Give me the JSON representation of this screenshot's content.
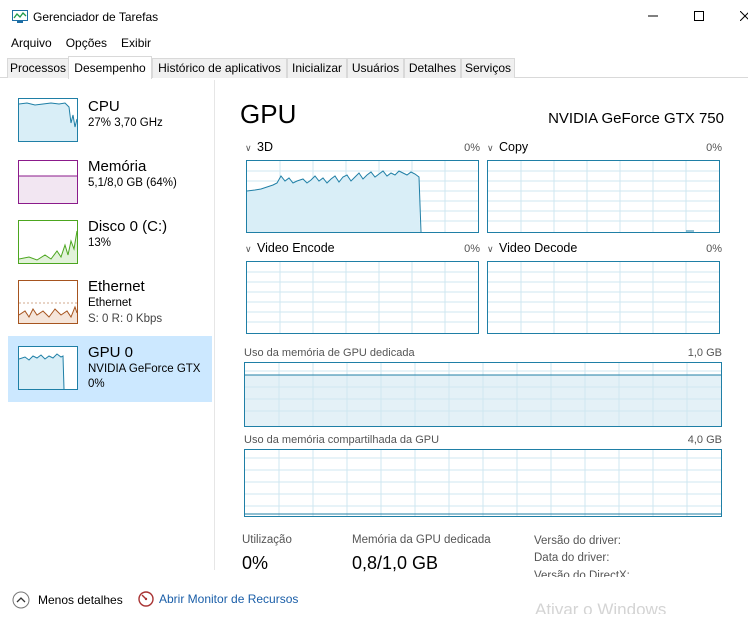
{
  "window": {
    "title": "Gerenciador de Tarefas"
  },
  "menu": [
    "Arquivo",
    "Opções",
    "Exibir"
  ],
  "tabs": [
    "Processos",
    "Desempenho",
    "Histórico de aplicativos",
    "Inicializar",
    "Usuários",
    "Detalhes",
    "Serviços"
  ],
  "active_tab": "Desempenho",
  "sidebar": {
    "cpu": {
      "name": "CPU",
      "sub": "27% 3,70 GHz"
    },
    "memory": {
      "name": "Memória",
      "sub": "5,1/8,0 GB (64%)"
    },
    "disk": {
      "name": "Disco 0 (C:)",
      "sub": "13%"
    },
    "ethernet": {
      "name": "Ethernet",
      "sub": "Ethernet",
      "sub2": "S: 0 R: 0 Kbps"
    },
    "gpu": {
      "name": "GPU 0",
      "sub": "NVIDIA GeForce GTX 750",
      "sub2": "0%"
    }
  },
  "colors": {
    "cpu": "#1f7fa6",
    "memory": "#8b1a8b",
    "disk": "#4ca61f",
    "ethernet": "#a6541f",
    "gpu": "#1f7fa6"
  },
  "main": {
    "title": "GPU",
    "model": "NVIDIA GeForce GTX 750",
    "graphs": {
      "g3d": {
        "label": "3D",
        "pct": "0%"
      },
      "copy": {
        "label": "Copy",
        "pct": "0%"
      },
      "encode": {
        "label": "Video Encode",
        "pct": "0%"
      },
      "decode": {
        "label": "Video Decode",
        "pct": "0%"
      }
    },
    "dedicated": {
      "label": "Uso da memória de GPU dedicada",
      "max": "1,0 GB"
    },
    "shared": {
      "label": "Uso da memória compartilhada da GPU",
      "max": "4,0 GB"
    },
    "stats": {
      "util_label": "Utilização",
      "util_value": "0%",
      "mem_label": "Memória da GPU dedicada",
      "mem_value": "0,8/1,0 GB",
      "driver_version": "Versão do driver:",
      "driver_date": "Data do driver:",
      "directx": "Versão do DirectX:"
    }
  },
  "footer": {
    "less": "Menos detalhes",
    "monitor": "Abrir Monitor de Recursos"
  },
  "watermark": "Ativar o Windows"
}
